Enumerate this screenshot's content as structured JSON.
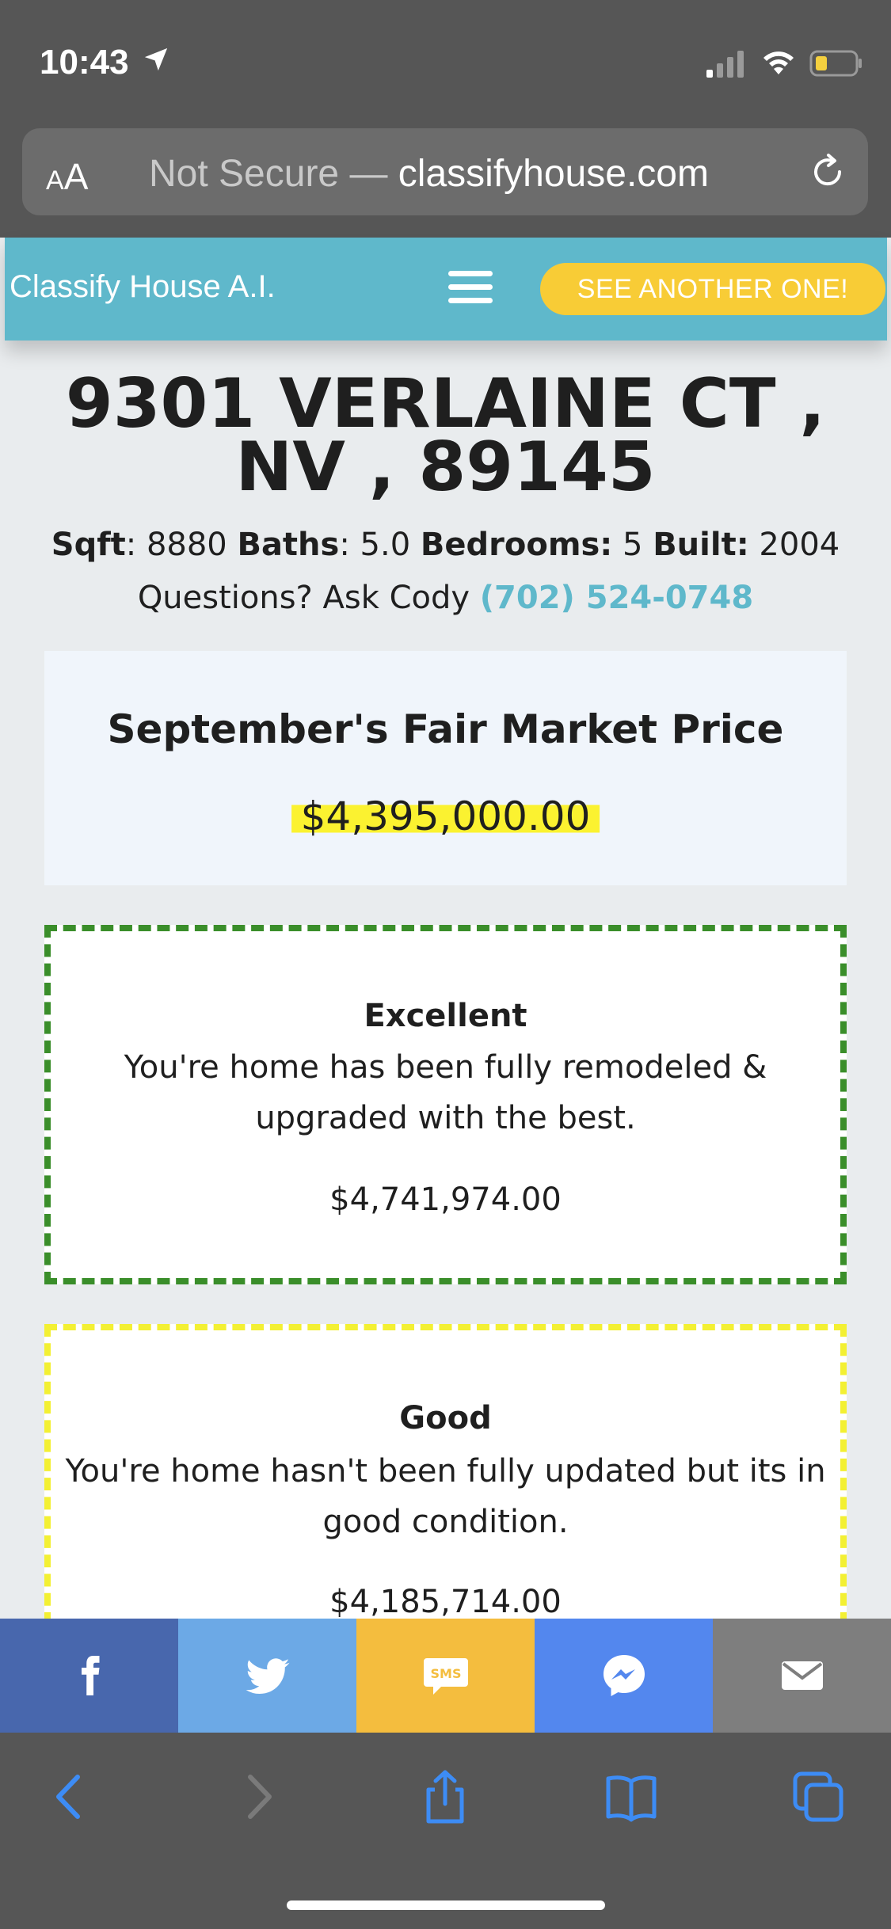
{
  "status_bar": {
    "time": "10:43"
  },
  "browser": {
    "aa_small": "A",
    "aa_big": "A",
    "security_label": "Not Secure",
    "separator": " — ",
    "domain": "classifyhouse.com"
  },
  "site_header": {
    "brand": "Classify House A.I.",
    "cta_label": "SEE ANOTHER ONE!"
  },
  "property": {
    "address_line1": "9301 VERLAINE CT ,",
    "address_line2": "NV , 89145",
    "sqft_label": "Sqft",
    "sqft_value": ": 8880 ",
    "baths_label": "Baths",
    "baths_value": ": 5.0 ",
    "bedrooms_label": "Bedrooms:",
    "bedrooms_value": " 5 ",
    "built_label": "Built:",
    "built_value": " 2004",
    "contact_prefix": "Questions? Ask Cody ",
    "contact_phone": "(702) 524-0748"
  },
  "fair_market": {
    "title": "September's Fair Market Price",
    "price": "$4,395,000.00"
  },
  "conditions": [
    {
      "name": "Excellent",
      "description": "You're home has been fully remodeled & upgraded with the best.",
      "price": "$4,741,974.00",
      "border_color": "#3a8e2a"
    },
    {
      "name": "Good",
      "description": "You're home hasn't been fully updated but its in good condition.",
      "price": "$4,185,714.00",
      "border_color": "#f3f033"
    }
  ],
  "share": {
    "sms_label": "SMS",
    "colors": {
      "facebook": "#4867ad",
      "twitter": "#6ca9e6",
      "sms": "#f4bd3e",
      "messenger": "#5387ee",
      "email": "#7e7e7e"
    }
  },
  "colors": {
    "accent": "#5fb8cb",
    "cta": "#f8cc36",
    "highlight": "#fbf230"
  }
}
